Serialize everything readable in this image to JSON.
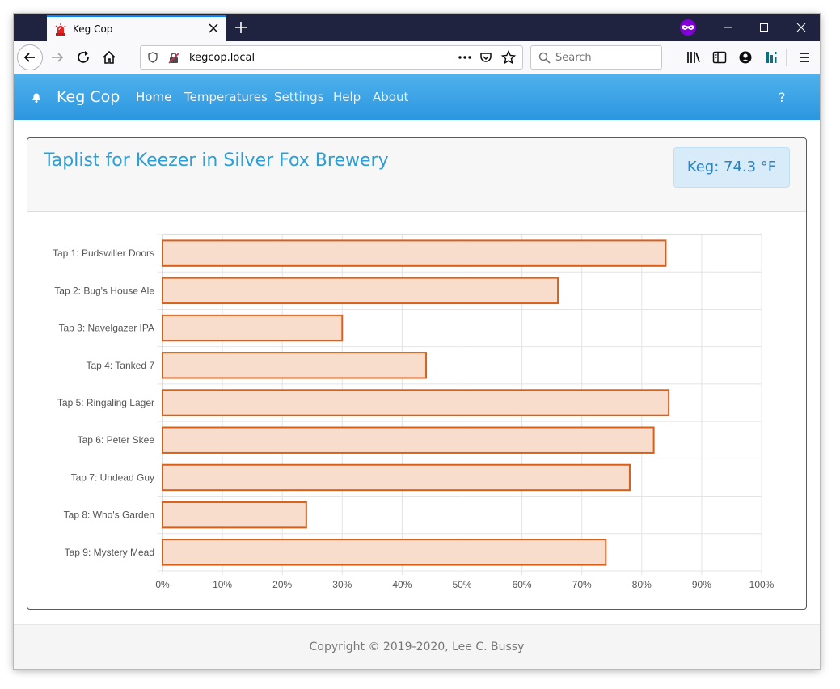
{
  "browser": {
    "tab_title": "Keg Cop",
    "url": "kegcop.local",
    "search_placeholder": "Search"
  },
  "site": {
    "brand": "Keg Cop",
    "nav": [
      "Home",
      "Temperatures",
      "Settings",
      "Help",
      "About"
    ],
    "help_label": "?"
  },
  "card": {
    "title": "Taplist for Keezer in Silver Fox Brewery",
    "keg_temp": "Keg: 74.3 °F"
  },
  "chart_data": {
    "type": "bar",
    "orientation": "horizontal",
    "categories": [
      "Tap 1: Pudswiller Doors",
      "Tap 2: Bug's House Ale",
      "Tap 3: Navelgazer IPA",
      "Tap 4: Tanked 7",
      "Tap 5: Ringaling Lager",
      "Tap 6: Peter Skee",
      "Tap 7: Undead Guy",
      "Tap 8: Who's Garden",
      "Tap 9: Mystery Mead"
    ],
    "values": [
      84,
      66,
      30,
      44,
      84.5,
      82,
      78,
      24,
      74
    ],
    "xlim": [
      0,
      100
    ],
    "x_ticks": [
      "0%",
      "10%",
      "20%",
      "30%",
      "40%",
      "50%",
      "60%",
      "70%",
      "80%",
      "90%",
      "100%"
    ],
    "grid": true,
    "bar_fill": "#f8ddcc",
    "bar_stroke": "#d9601a"
  },
  "footer": {
    "text": "Copyright © 2019-2020, Lee C. Bussy"
  }
}
